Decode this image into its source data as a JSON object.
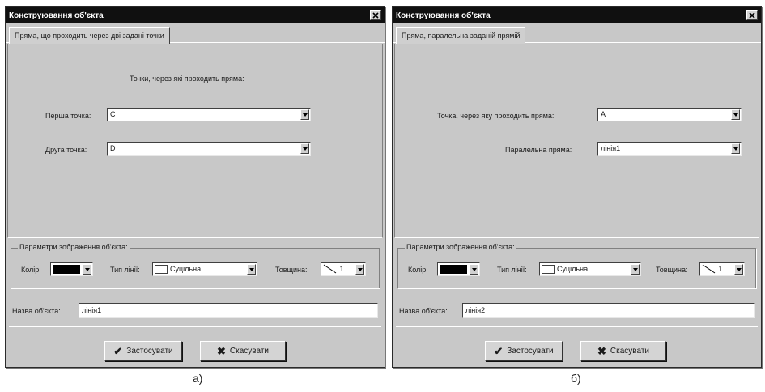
{
  "dialog_a": {
    "title": "Конструювання об'єкта",
    "tab": "Пряма, що проходить через дві задані точки",
    "heading": "Точки, через які проходить пряма:",
    "field1_label": "Перша точка:",
    "field1_value": "C",
    "field2_label": "Друга точка:",
    "field2_value": "D",
    "display_group": "Параметри зображення об'єкта:",
    "color_label": "Колір:",
    "line_type_label": "Тип лінії:",
    "line_type_value": "Суцільна",
    "thickness_label": "Товщина:",
    "thickness_value": "1",
    "name_label": "Назва об'єкта:",
    "name_value": "лінія1",
    "apply_label": "Застосувати",
    "cancel_label": "Скасувати",
    "caption": "а)"
  },
  "dialog_b": {
    "title": "Конструювання об'єкта",
    "tab": "Пряма, паралельна заданій прямій",
    "field1_label": "Точка, через яку проходить пряма:",
    "field1_value": "A",
    "field2_label": "Паралельна пряма:",
    "field2_value": "лінія1",
    "display_group": "Параметри зображення об'єкта:",
    "color_label": "Колір:",
    "line_type_label": "Тип лінії:",
    "line_type_value": "Суцільна",
    "thickness_label": "Товщина:",
    "thickness_value": "1",
    "name_label": "Назва об'єкта:",
    "name_value": "лінія2",
    "apply_label": "Застосувати",
    "cancel_label": "Скасувати",
    "caption": "б)"
  },
  "icons": {
    "close": "close-icon",
    "dropdown": "chevron-down-icon",
    "apply": "checkmark-icon",
    "cancel": "x-icon"
  },
  "colors": {
    "title_bar": "#101010",
    "dialog_bg": "#c8c8c8",
    "color_swatch": "#000000"
  }
}
